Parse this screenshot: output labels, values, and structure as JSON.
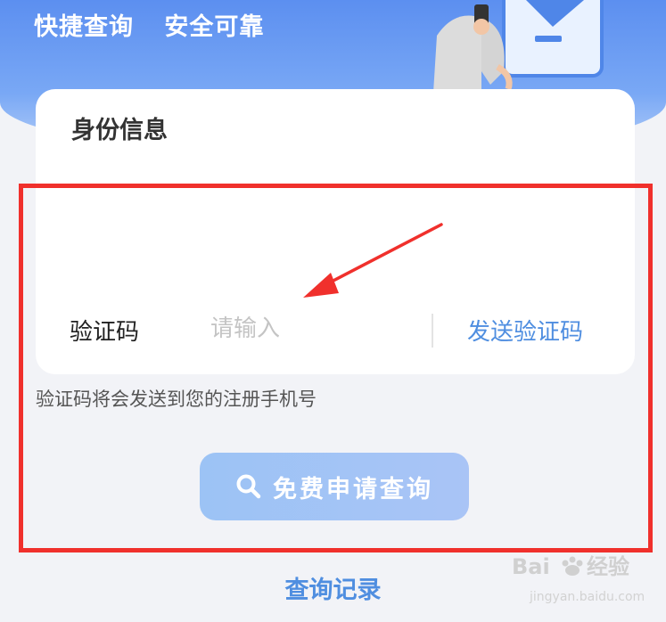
{
  "banner": {
    "tagline_left": "快捷查询",
    "tagline_right": "安全可靠"
  },
  "card": {
    "title": "身份信息",
    "code_label": "验证码",
    "code_placeholder": "请输入",
    "send_code_label": "发送验证码"
  },
  "hint": "验证码将会发送到您的注册手机号",
  "apply_button_label": "免费申请查询",
  "records_link_label": "查询记录",
  "watermark": {
    "brand": "Bai 经验",
    "domain": "jingyan.baidu.com"
  },
  "colors": {
    "accent": "#4f8ee0",
    "highlight": "#f0302c",
    "banner": "#6f9ef3"
  }
}
